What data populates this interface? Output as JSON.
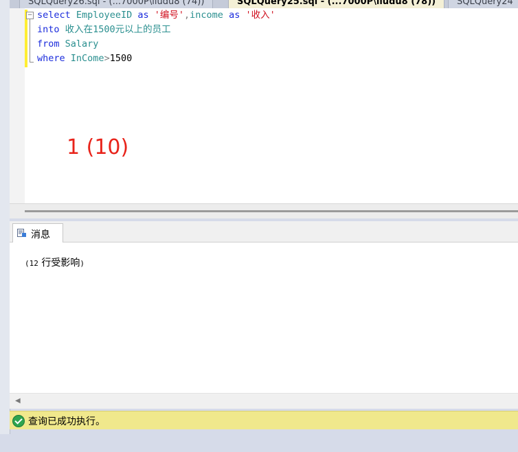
{
  "tabs": [
    {
      "label": "SQLQuery26.sql - (...7000P\\liudu8 (74))"
    },
    {
      "label": "SQLQuery25.sql - (...7000P\\liudu8 (78))"
    },
    {
      "label": "SQLQuery24"
    }
  ],
  "editor": {
    "line1": {
      "kw_select": "select",
      "col1": "EmployeeID",
      "kw_as1": "as",
      "alias1": "'编号'",
      "comma": ",",
      "col2": "income",
      "kw_as2": "as",
      "alias2": "'收入'"
    },
    "line2": {
      "kw_into": "into",
      "target": "收入在1500元以上的员工"
    },
    "line3": {
      "kw_from": "from",
      "table": "Salary"
    },
    "line4": {
      "kw_where": "where",
      "col": "InCome",
      "op": ">",
      "value": "1500"
    }
  },
  "annotation": "1 (10)",
  "results": {
    "tab_label": "消息",
    "message_prefix": "(12",
    "message_text": " 行受影响",
    "message_suffix": ")"
  },
  "status": {
    "text": "查询已成功执行。"
  },
  "colors": {
    "keyword": "#1a2bdc",
    "identifier": "#2a8f8f",
    "string": "#d0101f",
    "status_bg": "#f0e88c",
    "annotation": "#e8231a"
  }
}
